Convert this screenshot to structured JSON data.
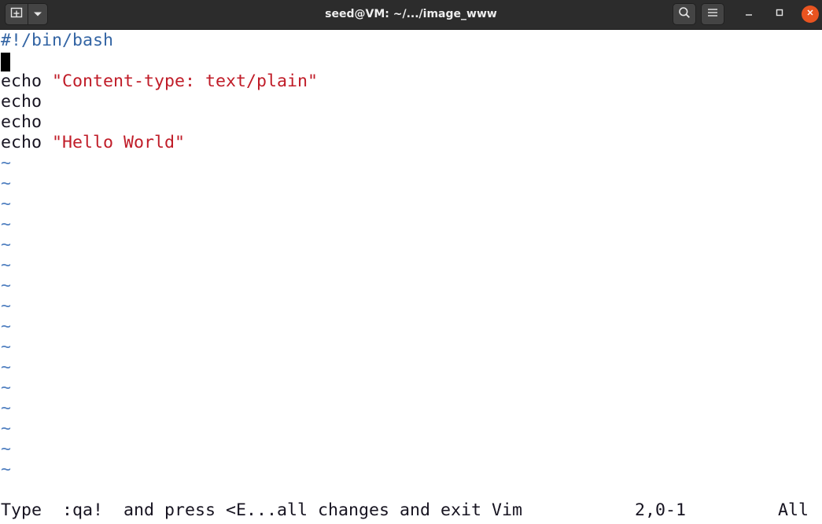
{
  "window": {
    "title": "seed@VM: ~/.../image_www"
  },
  "titlebar": {
    "icons": {
      "new_tab": "new-tab-icon",
      "dropdown": "chevron-down-icon",
      "search": "search-icon",
      "menu": "hamburger-menu-icon",
      "minimize": "minimize-icon",
      "maximize": "maximize-icon",
      "close": "close-icon"
    },
    "close_color": "#e95420"
  },
  "editor": {
    "lines": [
      "#!/bin/bash",
      "",
      "echo",
      "\"Content-type: text/plain\"",
      "echo",
      "echo",
      "echo",
      "\"Hello World\""
    ],
    "tilde": "~",
    "empty_line_count": 16,
    "colors": {
      "shebang": "#3465a4",
      "string": "#c01c28",
      "tilde": "#4f7fc0",
      "text": "#171421"
    }
  },
  "statusline": {
    "message": "Type  :qa!  and press <E...all changes and exit Vim",
    "position": "2,0-1",
    "scroll": "All"
  }
}
